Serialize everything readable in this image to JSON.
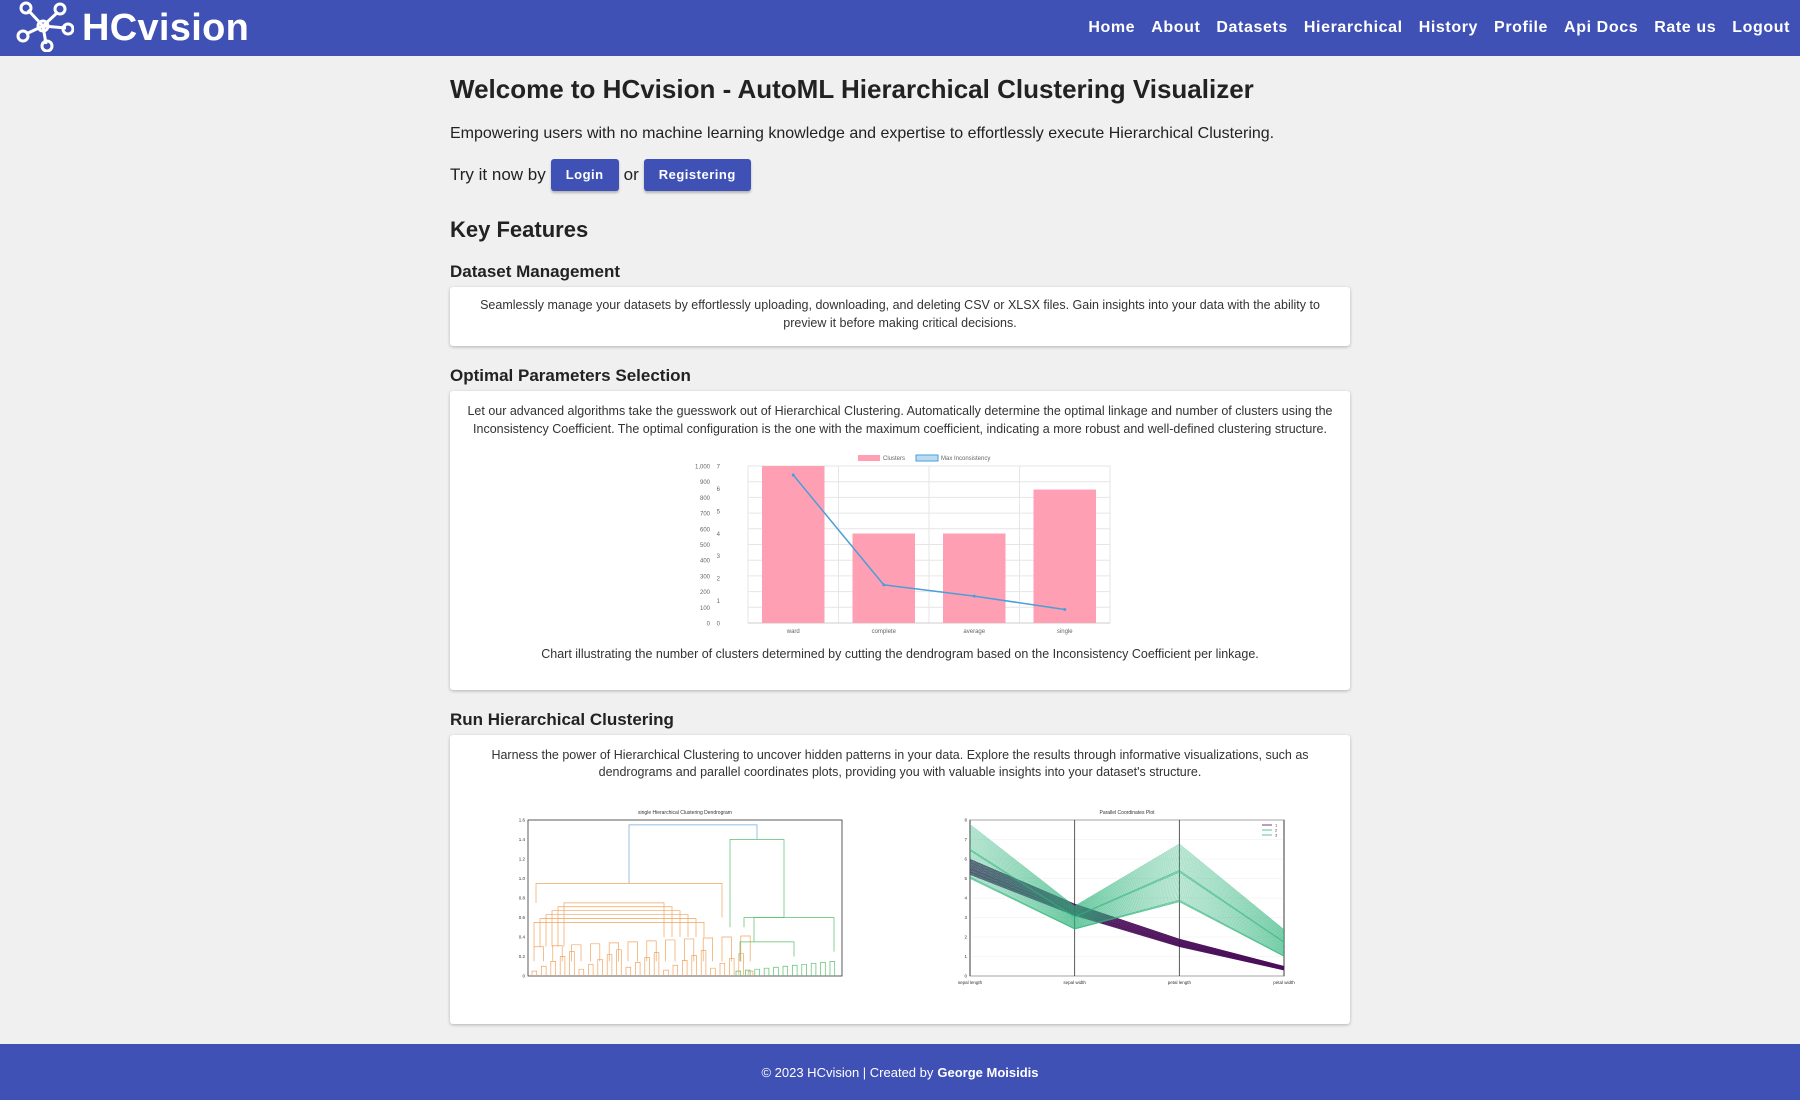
{
  "nav": {
    "brand": "HCvision",
    "links": [
      "Home",
      "About",
      "Datasets",
      "Hierarchical",
      "History",
      "Profile",
      "Api Docs",
      "Rate us",
      "Logout"
    ]
  },
  "main": {
    "title": "Welcome to HCvision - AutoML Hierarchical Clustering Visualizer",
    "intro": "Empowering users with no machine learning knowledge and expertise to effortlessly execute Hierarchical Clustering.",
    "try_prefix": "Try it now by",
    "login_label": "Login",
    "or_text": "or",
    "register_label": "Registering",
    "key_features_heading": "Key Features"
  },
  "features": [
    {
      "title": "Dataset Management",
      "text": "Seamlessly manage your datasets by effortlessly uploading, downloading, and deleting CSV or XLSX files. Gain insights into your data with the ability to preview it before making critical decisions."
    },
    {
      "title": "Optimal Parameters Selection",
      "text": "Let our advanced algorithms take the guesswork out of Hierarchical Clustering. Automatically determine the optimal linkage and number of clusters using the Inconsistency Coefficient. The optimal configuration is the one with the maximum coefficient, indicating a more robust and well-defined clustering structure.",
      "caption": "Chart illustrating the number of clusters determined by cutting the dendrogram based on the Inconsistency Coefficient per linkage."
    },
    {
      "title": "Run Hierarchical Clustering",
      "text": "Harness the power of Hierarchical Clustering to uncover hidden patterns in your data. Explore the results through informative visualizations, such as dendrograms and parallel coordinates plots, providing you with valuable insights into your dataset's structure."
    }
  ],
  "chart_data": [
    {
      "type": "bar",
      "categories": [
        "ward",
        "complete",
        "average",
        "single"
      ],
      "series": [
        {
          "name": "Clusters",
          "type": "bar",
          "axis": "left",
          "color": "#ff9fb3",
          "values": [
            1000,
            570,
            570,
            850
          ]
        },
        {
          "name": "Max Inconsistency",
          "type": "line",
          "axis": "right",
          "color": "#4a9fd8",
          "values": [
            6.6,
            1.7,
            1.2,
            0.6
          ]
        }
      ],
      "y_left": {
        "ylim": [
          0,
          1000
        ],
        "ticks": [
          "0",
          "100",
          "200",
          "300",
          "400",
          "500",
          "600",
          "700",
          "800",
          "900",
          "1,000"
        ]
      },
      "y_right": {
        "ylim": [
          0,
          7
        ],
        "ticks": [
          "0",
          "1",
          "2",
          "3",
          "4",
          "5",
          "6",
          "7"
        ]
      },
      "legend_position": "top",
      "grid": true
    },
    {
      "type": "line",
      "title": "single Hierarchical Clustering Dendrogram",
      "ylim": [
        0,
        1.6
      ],
      "y_ticks": [
        "0",
        "0.2",
        "0.4",
        "0.6",
        "0.8",
        "1.0",
        "1.2",
        "1.4",
        "1.6"
      ],
      "link_colors": [
        "#f0a35e",
        "#5bbf6e",
        "#6fa8dc"
      ]
    },
    {
      "type": "line",
      "title": "Parallel Coordinates Plot",
      "categories": [
        "sepal length",
        "sepal width",
        "petal length",
        "petal width"
      ],
      "y_ticks": [
        "0",
        "1",
        "2",
        "3",
        "4",
        "5",
        "6",
        "7",
        "8"
      ],
      "legend": [
        "1",
        "2",
        "3"
      ],
      "series_colors": [
        "#4b0f5a",
        "#2fb47c",
        "#2fb47c"
      ]
    }
  ],
  "footer": {
    "prefix": "© 2023 HCvision | Created by",
    "author": "George Moisidis"
  },
  "colors": {
    "primary": "#3f51b5",
    "background": "#f0f0f0"
  }
}
